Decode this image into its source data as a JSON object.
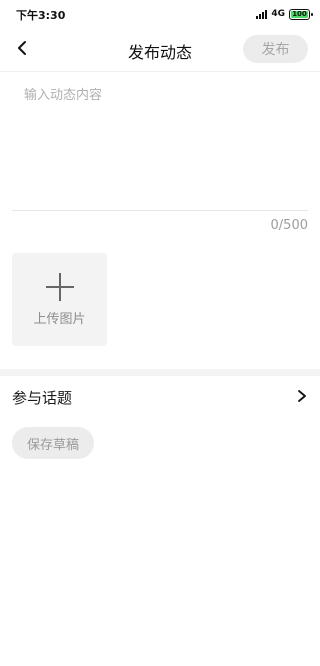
{
  "status_bar": {
    "time": "下午3:30",
    "network": "4G",
    "battery": "100",
    "battery_level": 1.0
  },
  "header": {
    "back_icon": "chevron-left-icon",
    "title": "发布动态",
    "publish_label": "发布"
  },
  "editor": {
    "placeholder": "输入动态内容",
    "value": "",
    "counter": "0/500"
  },
  "upload": {
    "icon": "plus-icon",
    "label": "上传图片"
  },
  "topic": {
    "label": "参与话题",
    "icon": "chevron-right-icon"
  },
  "draft": {
    "save_label": "保存草稿"
  },
  "colors": {
    "background": "#ffffff",
    "button_bg": "#ececec",
    "button_text": "#a6a6a6",
    "placeholder": "#b0b0b0",
    "battery_fill": "#4cd964"
  }
}
